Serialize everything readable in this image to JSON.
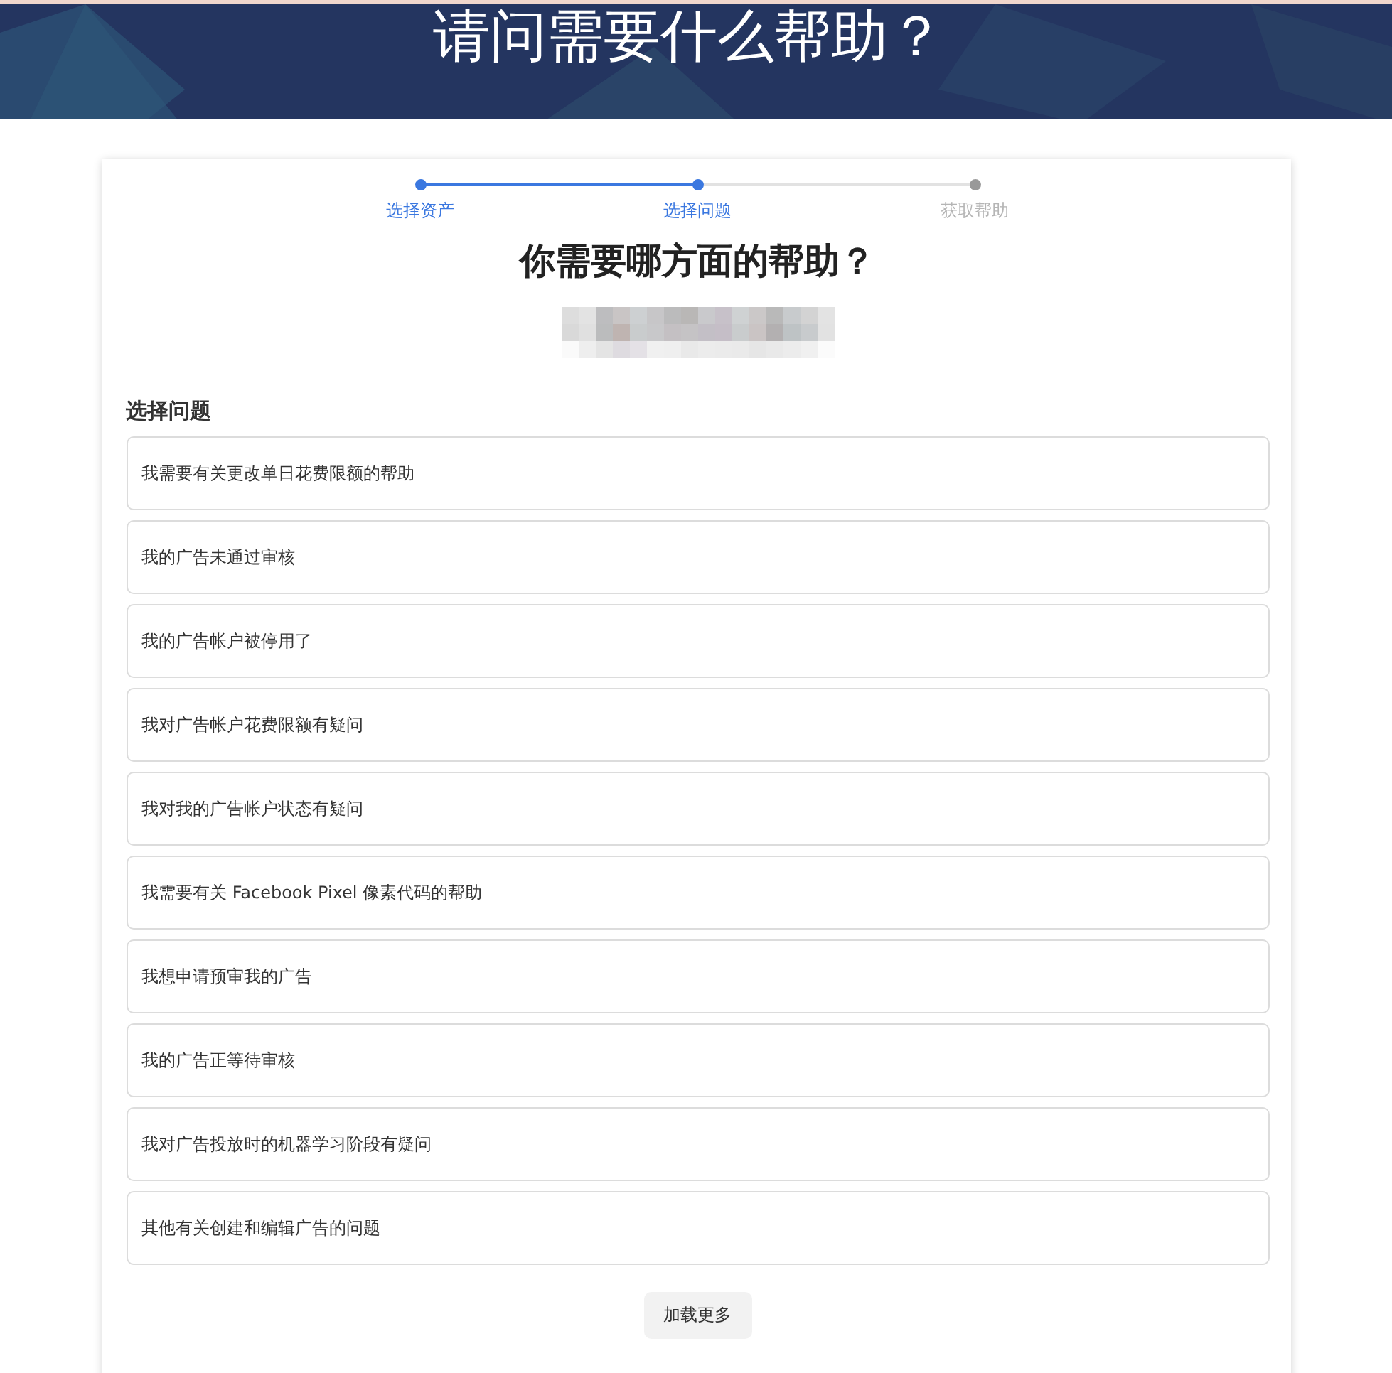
{
  "banner": {
    "title": "请问需要什么帮助？"
  },
  "steps": [
    {
      "label": "选择资产",
      "reached": true
    },
    {
      "label": "选择问题",
      "reached": true
    },
    {
      "label": "获取帮助",
      "reached": false
    }
  ],
  "heading": "你需要哪方面的帮助？",
  "section_title": "选择问题",
  "issues": [
    "我需要有关更改单日花费限额的帮助",
    "我的广告未通过审核",
    "我的广告帐户被停用了",
    "我对广告帐户花费限额有疑问",
    "我对我的广告帐户状态有疑问",
    "我需要有关 Facebook Pixel 像素代码的帮助",
    "我想申请预审我的广告",
    "我的广告正等待审核",
    "我对广告投放时的机器学习阶段有疑问",
    "其他有关创建和编辑广告的问题"
  ],
  "load_more": "加载更多"
}
